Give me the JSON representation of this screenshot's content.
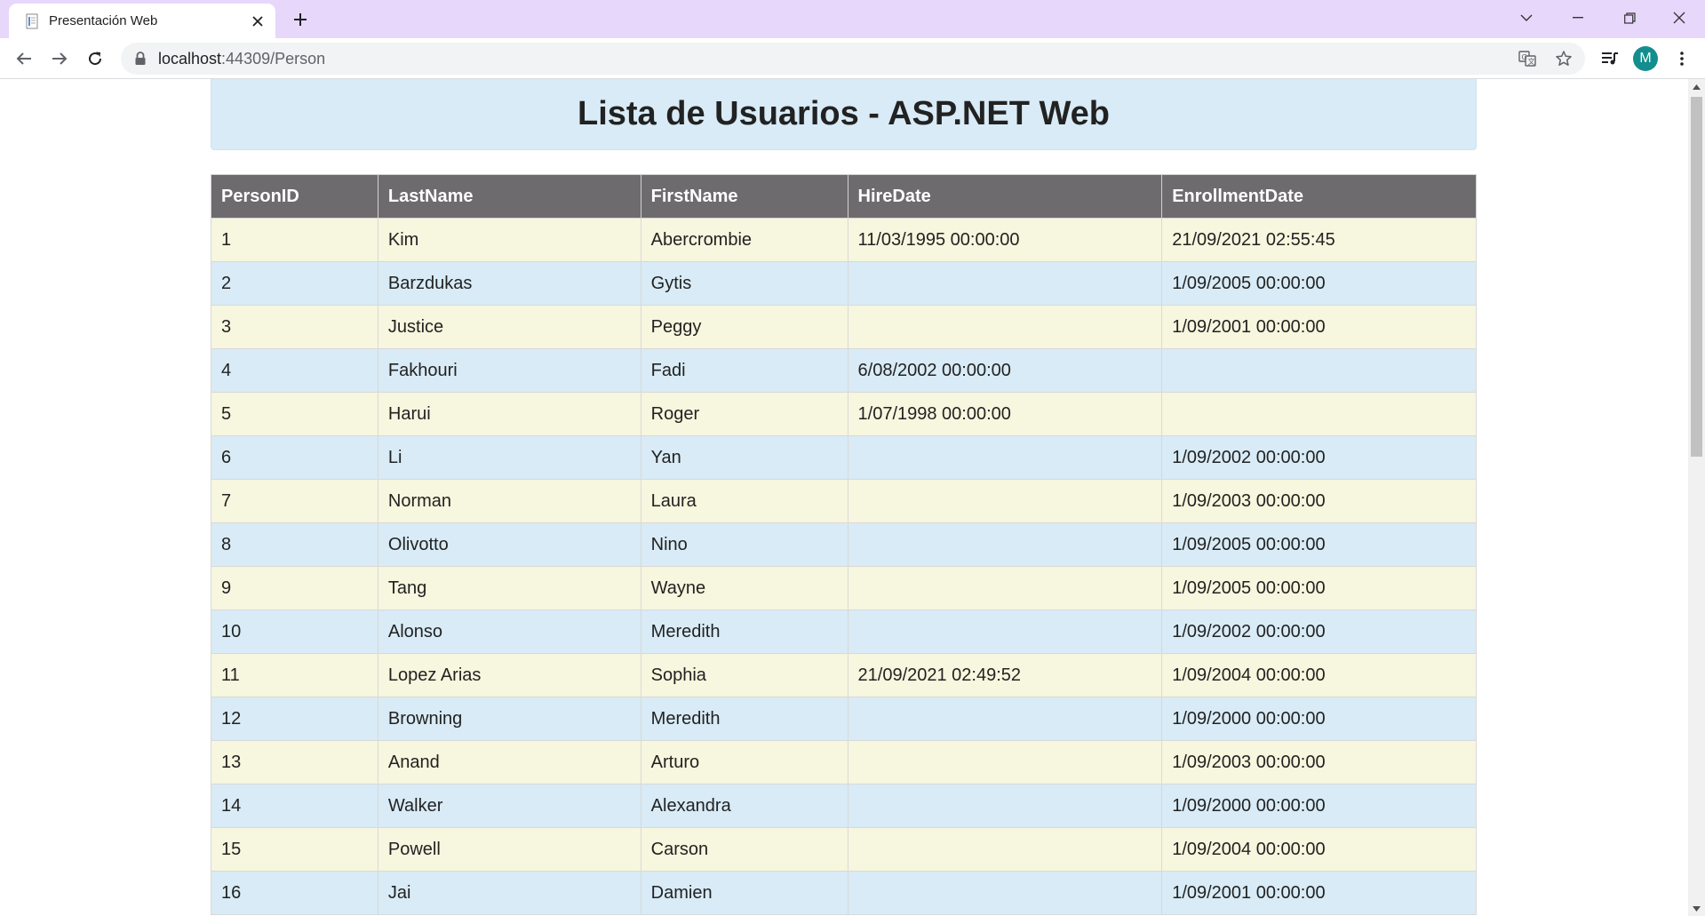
{
  "browser": {
    "tab": {
      "title": "Presentación Web",
      "active": true
    },
    "address": {
      "host": "localhost",
      "port_path": ":44309/Person"
    },
    "avatar_letter": "M",
    "accent_color": "#138e8e",
    "icons": [
      "page-favicon-icon",
      "close-icon",
      "plus-icon",
      "chevron-down-icon",
      "minimize-icon",
      "restore-icon",
      "close-window-icon",
      "back-arrow-icon",
      "forward-arrow-icon",
      "reload-icon",
      "lock-icon",
      "translate-icon",
      "star-icon",
      "media-queue-icon",
      "menu-dots-icon"
    ]
  },
  "page": {
    "title": "Lista de Usuarios - ASP.NET Web",
    "table": {
      "headers": [
        "PersonID",
        "LastName",
        "FirstName",
        "HireDate",
        "EnrollmentDate"
      ],
      "rows": [
        [
          "1",
          "Kim",
          "Abercrombie",
          "11/03/1995 00:00:00",
          "21/09/2021 02:55:45"
        ],
        [
          "2",
          "Barzdukas",
          "Gytis",
          "",
          "1/09/2005 00:00:00"
        ],
        [
          "3",
          "Justice",
          "Peggy",
          "",
          "1/09/2001 00:00:00"
        ],
        [
          "4",
          "Fakhouri",
          "Fadi",
          "6/08/2002 00:00:00",
          ""
        ],
        [
          "5",
          "Harui",
          "Roger",
          "1/07/1998 00:00:00",
          ""
        ],
        [
          "6",
          "Li",
          "Yan",
          "",
          "1/09/2002 00:00:00"
        ],
        [
          "7",
          "Norman",
          "Laura",
          "",
          "1/09/2003 00:00:00"
        ],
        [
          "8",
          "Olivotto",
          "Nino",
          "",
          "1/09/2005 00:00:00"
        ],
        [
          "9",
          "Tang",
          "Wayne",
          "",
          "1/09/2005 00:00:00"
        ],
        [
          "10",
          "Alonso",
          "Meredith",
          "",
          "1/09/2002 00:00:00"
        ],
        [
          "11",
          "Lopez Arias",
          "Sophia",
          "21/09/2021 02:49:52",
          "1/09/2004 00:00:00"
        ],
        [
          "12",
          "Browning",
          "Meredith",
          "",
          "1/09/2000 00:00:00"
        ],
        [
          "13",
          "Anand",
          "Arturo",
          "",
          "1/09/2003 00:00:00"
        ],
        [
          "14",
          "Walker",
          "Alexandra",
          "",
          "1/09/2000 00:00:00"
        ],
        [
          "15",
          "Powell",
          "Carson",
          "",
          "1/09/2004 00:00:00"
        ],
        [
          "16",
          "Jai",
          "Damien",
          "",
          "1/09/2001 00:00:00"
        ]
      ]
    },
    "colors": {
      "header_bg": "#6d6b6e",
      "row_odd": "#f7f6de",
      "row_even": "#d8ebf6",
      "jumbotron": "#d8ebf6"
    }
  }
}
